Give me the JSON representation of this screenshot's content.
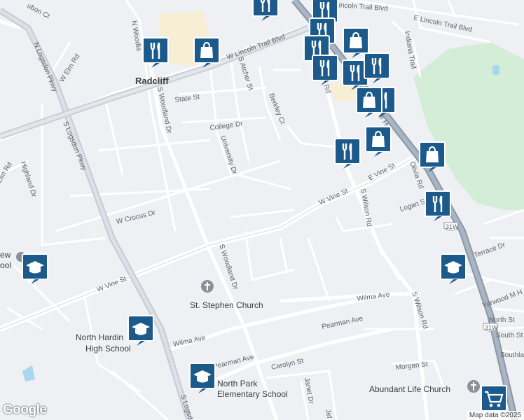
{
  "map": {
    "city_label": "Radcliff",
    "streets": {
      "w_lincoln_trail_blvd": "W Lincoln Trail Blvd",
      "e_lincoln_trail_blvd": "E Lincoln Trail Blvd",
      "lincoln_trail_blvd_top": "Lincoln Trail Blvd",
      "n_logsdon_pkwy": "N Logsdon Pkwy",
      "s_logsdon_pkwy": "S Logsdon Pkwy",
      "s_logsdon_bottom": "S Logsd",
      "n_woodland": "N Woodla",
      "s_woodland_dr_upper": "S Woodland Dr",
      "s_woodland_dr_lower": "S Woodland Dr",
      "w_elm_rd": "W Elm Rd",
      "elm_rd": "Elm Rd",
      "highland_dr": "Highland Dr",
      "state_st": "State St",
      "college_dr": "College Dr",
      "university_dr": "University Dr",
      "s_atcher_st": "S Atcher St",
      "berkley_ct": "Berkley Ct",
      "w_crocus_dr": "W Crocus Dr",
      "w_vine_st_left": "W Vine St",
      "w_vine_st_right": "W Vine St",
      "e_vine_st": "E Vine St",
      "s_wilson_rd_upper": "S Wilson Rd",
      "s_wilson_rd_lower": "S Wilson Rd",
      "olivia_rd": "Olivia Rd",
      "logan_st": "Logan St",
      "indiana_trail": "Indiana Trail",
      "terrace_dr": "Terrace Dr",
      "yarwood": "Yarwood M H",
      "north_st": "North St",
      "south_st": "South St",
      "southla": "Southla",
      "wilma_ave_left": "Wilma Ave",
      "wilma_ave_right": "Wilma Ave",
      "pearman_ave_left": "Pearman Ave",
      "pearman_ave_right": "Pearman Ave",
      "carolyn_st": "Carolyn St",
      "janet_dr": "Janet Dr",
      "morgan_st": "Morgan St",
      "top_ct": "ubon Ct",
      "hall_rd": "Rd",
      "dixie_hwy": "ie Hwy",
      "jef": "Jef"
    },
    "highway_shields": [
      "31W",
      "31W"
    ],
    "places": {
      "st_stephen_church": "St. Stephen Church",
      "north_hardin_hs_line1": "North Hardin",
      "north_hardin_hs_line2": "High School",
      "north_park_line1": "North Park",
      "north_park_line2": "Elementary School",
      "abundant_life_church": "Abundant Life Church",
      "new_school_line1": "ew",
      "new_school_line2": "ool"
    },
    "attribution": "Map data ©2025",
    "logo": "Google",
    "marker_color": "#1c5a8c"
  }
}
